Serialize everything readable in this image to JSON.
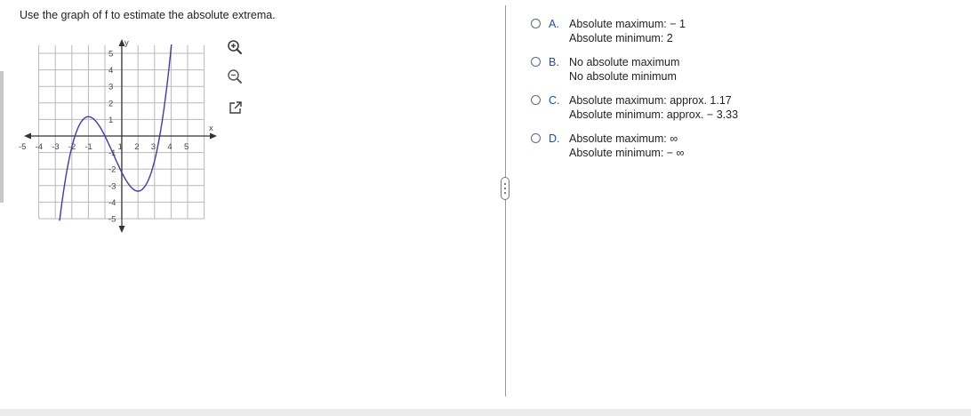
{
  "question": "Use the graph of f to estimate the absolute extrema.",
  "graph": {
    "axis_x_label": "x",
    "axis_y_label": "y",
    "x_ticks": [
      "-5",
      "-4",
      "-3",
      "-2",
      "-1",
      "1",
      "2",
      "3",
      "4",
      "5"
    ],
    "y_ticks": [
      "5",
      "4",
      "3",
      "2",
      "1",
      "-1",
      "-2",
      "-3",
      "-4",
      "-5"
    ],
    "curve_color": "#3b3bb0"
  },
  "tools": {
    "zoom_in_icon": "magnifier-plus-icon",
    "zoom_out_icon": "magnifier-minus-icon",
    "open_icon": "external-link-icon"
  },
  "options": [
    {
      "letter": "A.",
      "line1": "Absolute maximum:  − 1",
      "line2": "Absolute minimum: 2"
    },
    {
      "letter": "B.",
      "line1": "No absolute maximum",
      "line2": "No absolute minimum"
    },
    {
      "letter": "C.",
      "line1": "Absolute maximum: approx. 1.17",
      "line2": "Absolute minimum: approx.  − 3.33"
    },
    {
      "letter": "D.",
      "line1": "Absolute maximum: ∞",
      "line2": "Absolute minimum:  − ∞"
    }
  ],
  "colors": {
    "accent": "#1f4e9c",
    "grid": "#b8b8b8",
    "axis": "#333333"
  }
}
